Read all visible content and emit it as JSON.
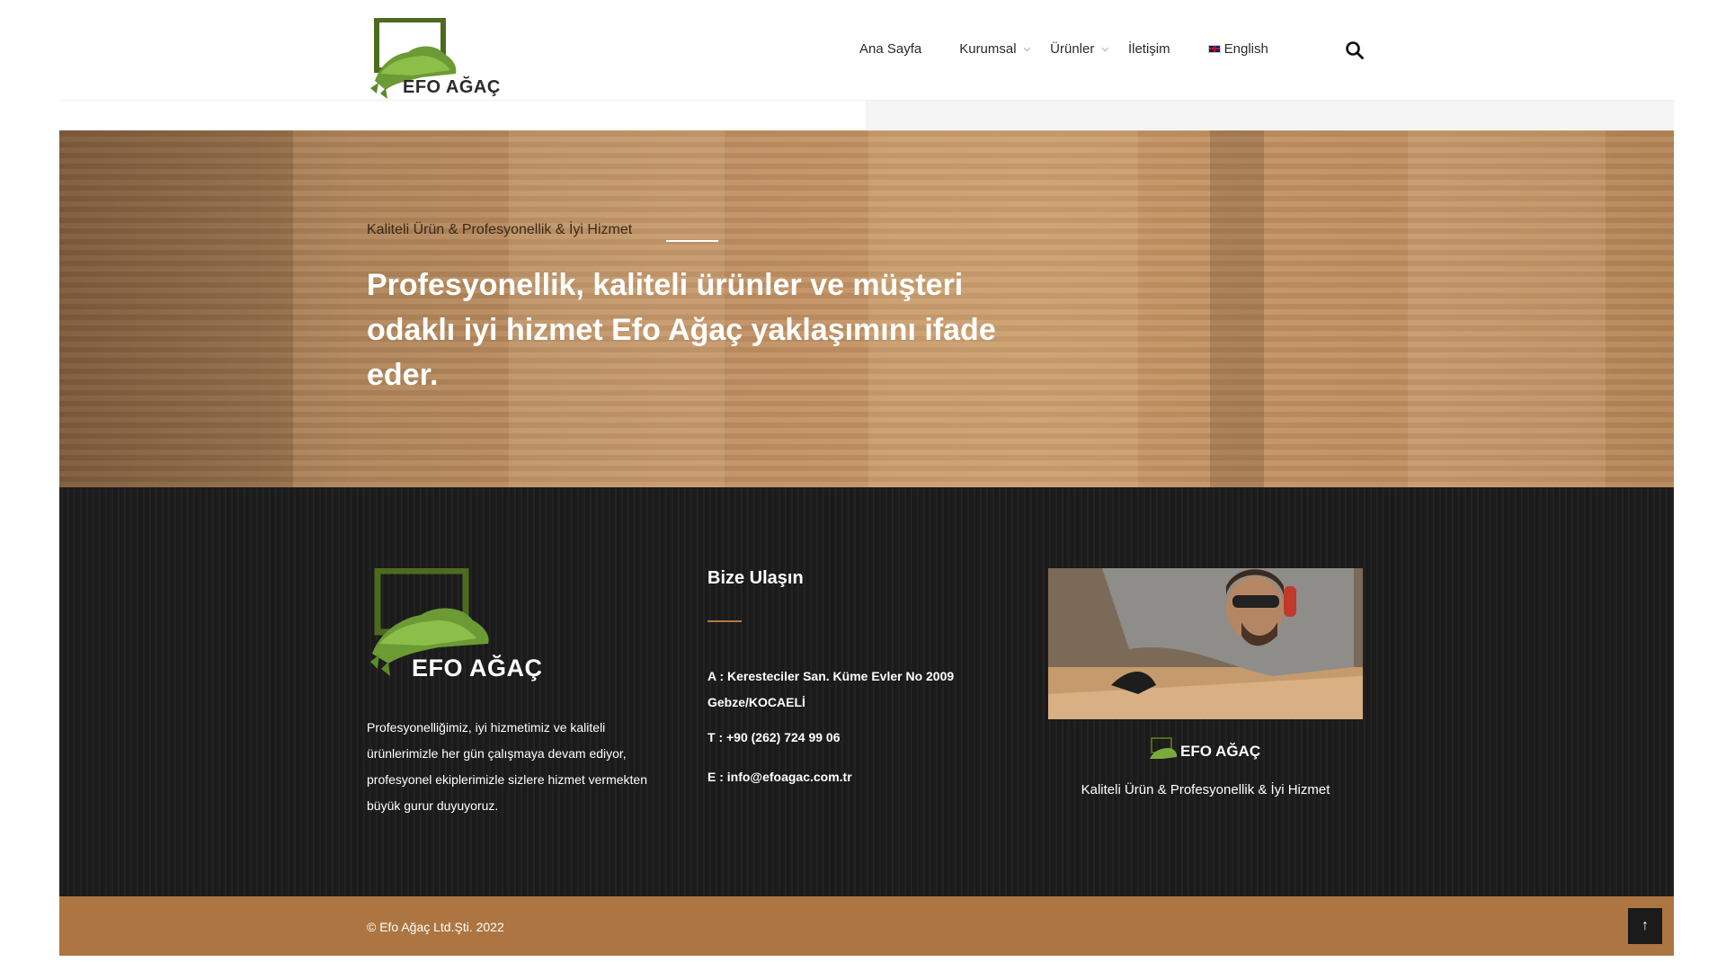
{
  "header": {
    "logo_text": "EFO AĞAÇ",
    "nav": [
      {
        "label": "Ana Sayfa",
        "has_dropdown": false
      },
      {
        "label": "Kurumsal",
        "has_dropdown": true
      },
      {
        "label": "Ürünler",
        "has_dropdown": true
      },
      {
        "label": "İletişim",
        "has_dropdown": false
      },
      {
        "label": "English",
        "has_dropdown": false,
        "icon": "uk-flag-icon"
      }
    ],
    "search_icon": "search-icon"
  },
  "hero": {
    "subtitle": "Kaliteli Ürün & Profesyonellik & İyi Hizmet",
    "title": "Profesyonellik, kaliteli ürünler ve müşteri odaklı iyi hizmet Efo Ağaç yaklaşımını ifade eder."
  },
  "footer": {
    "logo_text": "EFO AĞAÇ",
    "about": "Profesyonelliğimiz, iyi hizmetimiz ve kaliteli ürünlerimizle her gün çalışmaya devam ediyor, profesyonel ekiplerimizle sizlere hizmet vermekten büyük gurur duyuyoruz.",
    "contact": {
      "heading": "Bize Ulaşın",
      "address": "A : Keresteciler San. Küme Evler No 2009 Gebze/KOCAELİ",
      "phone": "T : +90 (262) 724 99 06",
      "email": "E : info@efoagac.com.tr"
    },
    "small_logo_text": "EFO AĞAÇ",
    "tagline": "Kaliteli Ürün & Profesyonellik & İyi Hizmet"
  },
  "bottom": {
    "copyright": "© Efo Ağaç Ltd.Şti. 2022",
    "back_to_top": "↑"
  },
  "colors": {
    "accent": "#ad7541",
    "logo_green": "#5a8a2a",
    "logo_frame": "#4d6b1f",
    "footer_bg": "#1e1e1e"
  }
}
